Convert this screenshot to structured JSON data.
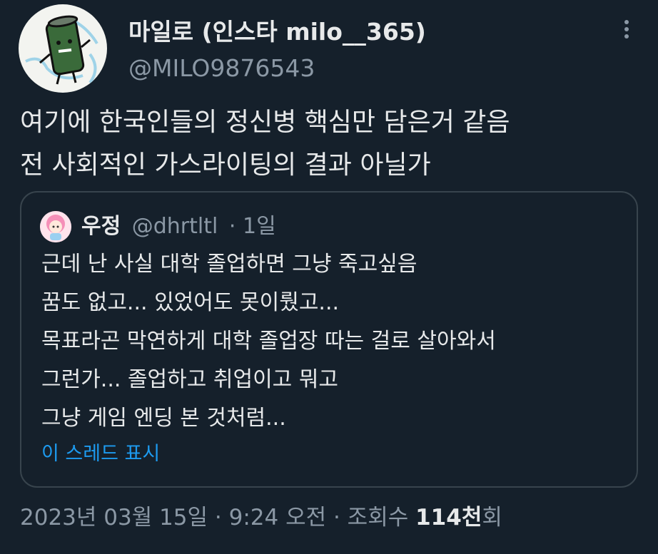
{
  "author": {
    "display_name": "마일로 (인스타 milo__365)",
    "handle": "@MILO9876543",
    "avatar_icon": "green-can-character-avatar"
  },
  "tweet": {
    "lines": [
      "여기에 한국인들의 정신병 핵심만 담은거 같음",
      "전 사회적인 가스라이팅의 결과 아닐가"
    ]
  },
  "quote": {
    "avatar_icon": "pink-hair-character-avatar",
    "name": "우정",
    "handle": "@dhrtltl",
    "separator": "·",
    "time": "1일",
    "lines": [
      "근데 난 사실 대학 졸업하면 그냥 죽고싶음",
      "꿈도 없고... 있었어도 못이뤘고...",
      "목표라곤 막연하게 대학 졸업장 따는 걸로 살아와서",
      "그런가... 졸업하고 취업이고 뭐고",
      "그냥 게임 엔딩 본 것처럼..."
    ],
    "show_thread": "이 스레드 표시"
  },
  "footer": {
    "datetime": "2023년 03월 15일 · 9:24 오전 · 조회수",
    "views": "114천",
    "views_suffix": "회"
  },
  "colors": {
    "background": "#15202b",
    "text": "#e7e9ea",
    "secondary": "#8b98a5",
    "link": "#1d9bf0",
    "border": "#38444d"
  }
}
